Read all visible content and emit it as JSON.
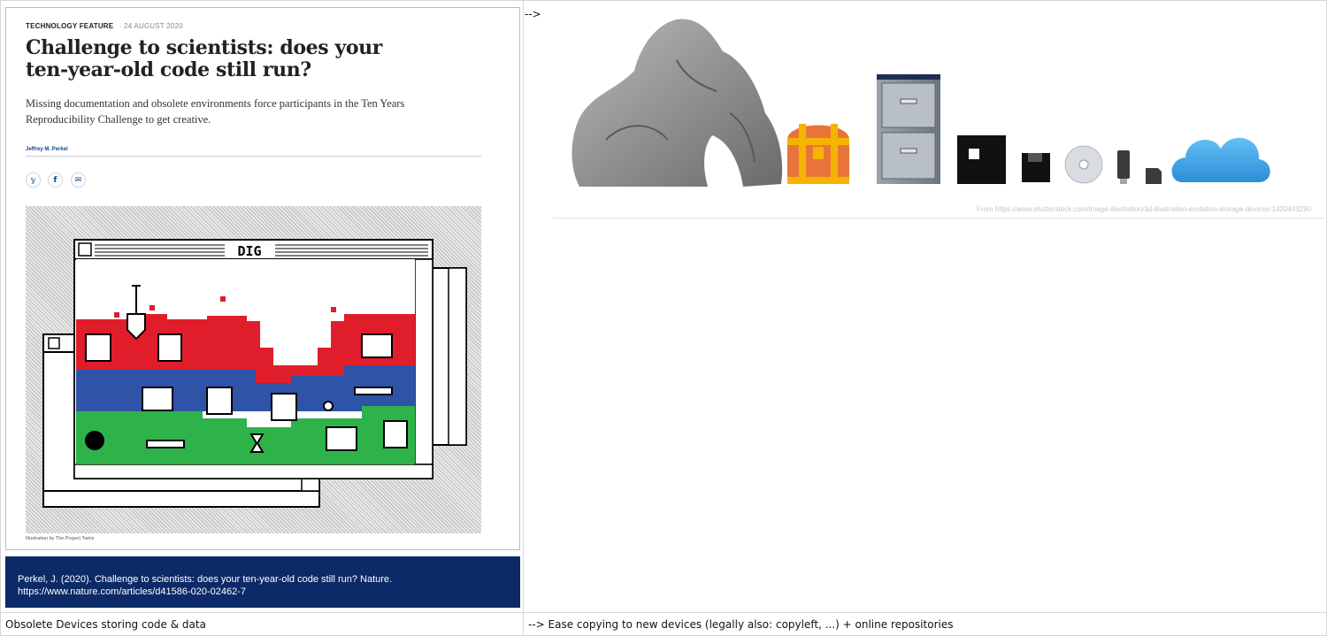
{
  "article": {
    "kicker": "TECHNOLOGY FEATURE",
    "date": "24 AUGUST 2020",
    "title": "Challenge to scientists: does your ten-year-old code still run?",
    "standfirst": "Missing documentation and obsolete environments force participants in the Ten Years Reproducibility Challenge to get creative.",
    "author": "Jeffrey M. Perkel",
    "share": [
      {
        "icon": "twitter-icon",
        "glyph": "𝕪"
      },
      {
        "icon": "facebook-icon",
        "glyph": "f"
      },
      {
        "icon": "email-icon",
        "glyph": "✉"
      }
    ],
    "illustration_window_title": "DIG",
    "illustration_credit": "Illustration by The Project Twins"
  },
  "reference": {
    "line1": "Perkel, J. (2020). Challenge to scientists: does your ten-year-old code still run? Nature.",
    "line2": "https://www.nature.com/articles/d41586-020-02462-7"
  },
  "top_right_marker": "-->",
  "storage_image": {
    "source": "From https://www.shutterstock.com/image-illustration/3d-illustration-evolution-storage-devices-1420443290",
    "items": [
      "rock-icon",
      "treasure-chest-icon",
      "filing-cabinet-icon",
      "floppy-disk-icon",
      "small-floppy-icon",
      "cd-icon",
      "usb-stick-icon",
      "sd-card-icon",
      "cloud-icon"
    ]
  },
  "captions": {
    "left": "Obsolete Devices storing code & data",
    "right": "--> Ease copying to new devices (legally also: copyleft, ...) + online repositories"
  },
  "colors": {
    "ref_bg": "#0c2a67",
    "dig_red": "#e01e2b",
    "dig_blue": "#2f53a6",
    "dig_green": "#2db34a",
    "cloud": "#3ea5e8"
  }
}
